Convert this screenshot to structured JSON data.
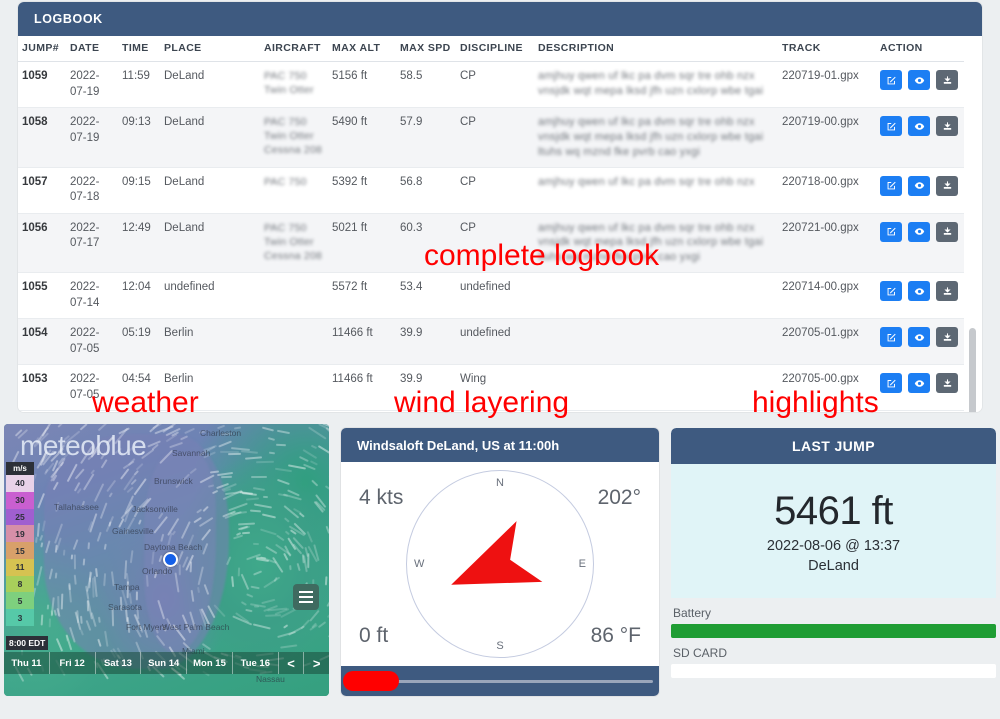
{
  "logbook": {
    "title": "LOGBOOK",
    "columns": [
      "JUMP#",
      "DATE",
      "TIME",
      "PLACE",
      "AIRCRAFT",
      "MAX ALT",
      "MAX SPD",
      "DISCIPLINE",
      "DESCRIPTION",
      "TRACK",
      "ACTION"
    ],
    "rows": [
      {
        "jump": "1059",
        "date": "2022-07-19",
        "time": "11:59",
        "place": "DeLand",
        "aircraft": "redacted",
        "max_alt": "5156 ft",
        "max_spd": "58.5",
        "discipline": "CP",
        "description": "redacted description text two lines",
        "track": "220719-01.gpx"
      },
      {
        "jump": "1058",
        "date": "2022-07-19",
        "time": "09:13",
        "place": "DeLand",
        "aircraft": "redacted",
        "max_alt": "5490 ft",
        "max_spd": "57.9",
        "discipline": "CP",
        "description": "redacted description text three lines",
        "track": "220719-00.gpx"
      },
      {
        "jump": "1057",
        "date": "2022-07-18",
        "time": "09:15",
        "place": "DeLand",
        "aircraft": "redacted",
        "max_alt": "5392 ft",
        "max_spd": "56.8",
        "discipline": "CP",
        "description": "redacted description text one line",
        "track": "220718-00.gpx"
      },
      {
        "jump": "1056",
        "date": "2022-07-17",
        "time": "12:49",
        "place": "DeLand",
        "aircraft": "redacted",
        "max_alt": "5021 ft",
        "max_spd": "60.3",
        "discipline": "CP",
        "description": "redacted description text two lines",
        "track": "220721-00.gpx"
      },
      {
        "jump": "1055",
        "date": "2022-07-14",
        "time": "12:04",
        "place": "undefined",
        "aircraft": "",
        "max_alt": "5572 ft",
        "max_spd": "53.4",
        "discipline": "undefined",
        "description": "",
        "track": "220714-00.gpx"
      },
      {
        "jump": "1054",
        "date": "2022-07-05",
        "time": "05:19",
        "place": "Berlin",
        "aircraft": "",
        "max_alt": "11466 ft",
        "max_spd": "39.9",
        "discipline": "undefined",
        "description": "",
        "track": "220705-01.gpx"
      },
      {
        "jump": "1053",
        "date": "2022-07-05",
        "time": "04:54",
        "place": "Berlin",
        "aircraft": "",
        "max_alt": "11466 ft",
        "max_spd": "39.9",
        "discipline": "Wing",
        "description": "",
        "track": "220705-00.gpx"
      }
    ],
    "action_icons": [
      "edit-icon",
      "eye-icon",
      "download-icon"
    ],
    "colors": {
      "header": "#3e5a80",
      "primary_button": "#1c7ef3",
      "download_button": "#5d6874"
    }
  },
  "annotations": {
    "logbook": "complete logbook",
    "weather": "weather",
    "wind": "wind layering",
    "highlights": "highlights",
    "color": "#ff0000"
  },
  "weather": {
    "brand": "meteoblue",
    "legend_unit": "m/s",
    "legend_values": [
      "40",
      "30",
      "25",
      "19",
      "15",
      "11",
      "8",
      "5",
      "3"
    ],
    "timestamp": "8:00 EDT",
    "days": [
      "Thu 11",
      "Fri 12",
      "Sat 13",
      "Sun 14",
      "Mon 15",
      "Tue 16"
    ],
    "prev_label": "<",
    "next_label": ">",
    "cities": [
      "Charleston",
      "Savannah",
      "Brunswick",
      "Tallahassee",
      "Jacksonville",
      "Gainesville",
      "Daytona Beach",
      "Orlando",
      "Tampa",
      "Sarasota",
      "Fort Myers",
      "West Palm Beach",
      "Miami",
      "Nassau"
    ],
    "menu_icon": "hamburger-menu-icon"
  },
  "windsaloft": {
    "title": "Windsaloft DeLand, US at 11:00h",
    "speed": "4 kts",
    "direction": "202°",
    "altitude": "0 ft",
    "temperature": "86 °F",
    "compass": {
      "n": "N",
      "e": "E",
      "s": "S",
      "w": "W"
    },
    "arrow_heading_deg": 202,
    "arrow_color": "#ee1111",
    "slider_value": 0
  },
  "highlights": {
    "title": "LAST JUMP",
    "altitude": "5461 ft",
    "datetime": "2022-08-06 @ 13:37",
    "place": "DeLand",
    "battery_label": "Battery",
    "battery_percent": 100,
    "battery_color": "#1f9d34",
    "sdcard_label": "SD CARD",
    "sdcard_percent": 0,
    "sdcard_color": "#1f9d34"
  }
}
